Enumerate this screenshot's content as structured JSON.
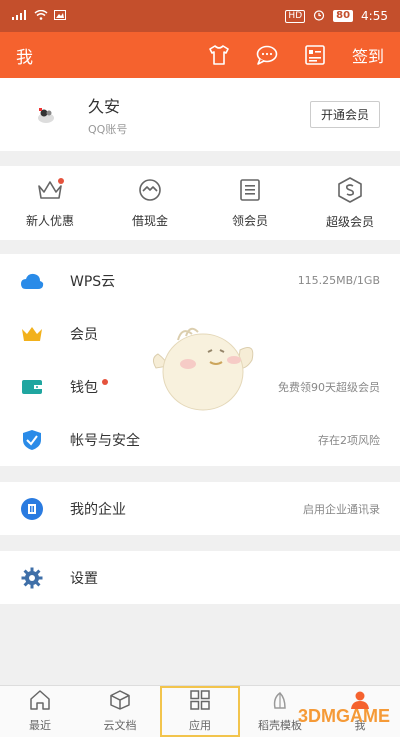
{
  "status_bar": {
    "hd": "HD",
    "battery": "80",
    "time": "4:55"
  },
  "header": {
    "title": "我",
    "signin": "签到"
  },
  "profile": {
    "name": "久安",
    "sub": "QQ账号",
    "vip_button": "开通会员"
  },
  "quick_actions": [
    {
      "label": "新人优惠",
      "icon": "crown-icon",
      "dot": true
    },
    {
      "label": "借现金",
      "icon": "exchange-icon"
    },
    {
      "label": "领会员",
      "icon": "list-card-icon"
    },
    {
      "label": "超级会员",
      "icon": "super-vip-icon"
    }
  ],
  "menu_group1": [
    {
      "label": "WPS云",
      "value": "115.25MB/1GB",
      "icon": "cloud-icon",
      "color": "#2a8be8"
    },
    {
      "label": "会员",
      "value": "",
      "icon": "crown-icon",
      "color": "#f2b11c"
    },
    {
      "label": "钱包",
      "value": "免费领90天超级会员",
      "icon": "wallet-icon",
      "color": "#20a6a0"
    },
    {
      "label": "帐号与安全",
      "value": "存在2项风险",
      "icon": "shield-icon",
      "color": "#2a8be8"
    }
  ],
  "menu_group2": [
    {
      "label": "我的企业",
      "value": "启用企业通讯录",
      "icon": "enterprise-icon",
      "color": "#2a7be0"
    }
  ],
  "menu_group3": [
    {
      "label": "设置",
      "value": "",
      "icon": "gear-icon",
      "color": "#3f6fa8"
    }
  ],
  "tabs": [
    {
      "label": "最近",
      "icon": "home-icon"
    },
    {
      "label": "云文档",
      "icon": "cube-icon"
    },
    {
      "label": "应用",
      "icon": "apps-icon"
    },
    {
      "label": "稻壳模板",
      "icon": "template-icon"
    },
    {
      "label": "我",
      "icon": "person-icon"
    }
  ],
  "watermark": "3DMGAME",
  "colors": {
    "accent": "#f5622e",
    "statusbar": "#c44f2c"
  }
}
